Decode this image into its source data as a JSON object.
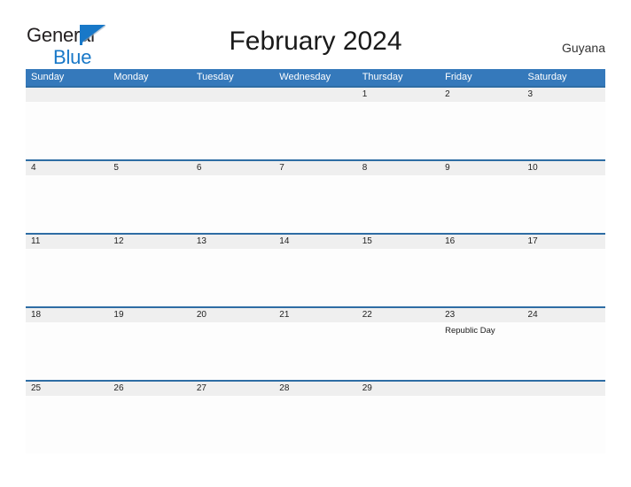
{
  "brand": {
    "name_part1": "General",
    "name_part2": "Blue",
    "flag_icon": "blue-flag-triangle-icon",
    "color_primary": "#1878c8",
    "color_text": "#231f20"
  },
  "header": {
    "title": "February 2024",
    "country": "Guyana"
  },
  "calendar": {
    "month": "February",
    "year": "2024",
    "header_bg": "#3579bb",
    "band_bg": "#efefef",
    "row_border": "#2e6da4",
    "weekdays": [
      "Sunday",
      "Monday",
      "Tuesday",
      "Wednesday",
      "Thursday",
      "Friday",
      "Saturday"
    ],
    "weeks": [
      [
        {
          "day": "",
          "events": []
        },
        {
          "day": "",
          "events": []
        },
        {
          "day": "",
          "events": []
        },
        {
          "day": "",
          "events": []
        },
        {
          "day": "1",
          "events": []
        },
        {
          "day": "2",
          "events": []
        },
        {
          "day": "3",
          "events": []
        }
      ],
      [
        {
          "day": "4",
          "events": []
        },
        {
          "day": "5",
          "events": []
        },
        {
          "day": "6",
          "events": []
        },
        {
          "day": "7",
          "events": []
        },
        {
          "day": "8",
          "events": []
        },
        {
          "day": "9",
          "events": []
        },
        {
          "day": "10",
          "events": []
        }
      ],
      [
        {
          "day": "11",
          "events": []
        },
        {
          "day": "12",
          "events": []
        },
        {
          "day": "13",
          "events": []
        },
        {
          "day": "14",
          "events": []
        },
        {
          "day": "15",
          "events": []
        },
        {
          "day": "16",
          "events": []
        },
        {
          "day": "17",
          "events": []
        }
      ],
      [
        {
          "day": "18",
          "events": []
        },
        {
          "day": "19",
          "events": []
        },
        {
          "day": "20",
          "events": []
        },
        {
          "day": "21",
          "events": []
        },
        {
          "day": "22",
          "events": []
        },
        {
          "day": "23",
          "events": [
            "Republic Day"
          ]
        },
        {
          "day": "24",
          "events": []
        }
      ],
      [
        {
          "day": "25",
          "events": []
        },
        {
          "day": "26",
          "events": []
        },
        {
          "day": "27",
          "events": []
        },
        {
          "day": "28",
          "events": []
        },
        {
          "day": "29",
          "events": []
        },
        {
          "day": "",
          "events": []
        },
        {
          "day": "",
          "events": []
        }
      ]
    ]
  }
}
